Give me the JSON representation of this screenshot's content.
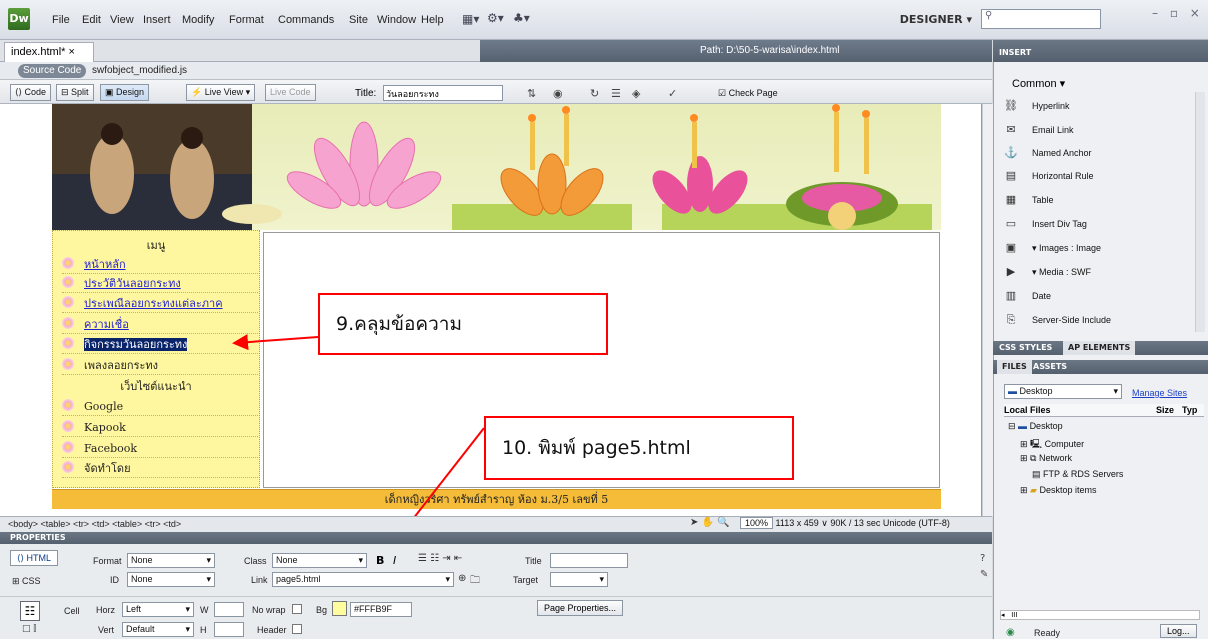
{
  "menubar": {
    "logo": "Dw",
    "items": [
      "File",
      "Edit",
      "View",
      "Insert",
      "Modify",
      "Format",
      "Commands",
      "Site",
      "Window",
      "Help"
    ],
    "workspace": "DESIGNER",
    "window_controls": "– ▫ ×"
  },
  "document": {
    "tab_label": "index.html*",
    "close": "×",
    "path": "Path:  D:\\50-5-warisa\\index.html",
    "source_code_label": "Source Code",
    "related_file": "swfobject_modified.js"
  },
  "toolbar": {
    "code": "Code",
    "split": "Split",
    "design": "Design",
    "live_view": "Live View",
    "live_code": "Live Code",
    "title_label": "Title:",
    "title_value": "วันลอยกระทง",
    "check_page": "Check Page"
  },
  "page": {
    "menu_heading": "เมนู",
    "menu_items": [
      {
        "label": "หน้าหลัก",
        "link": true
      },
      {
        "label": "ประวัติวันลอยกระทง",
        "link": true
      },
      {
        "label": "ประเพณีลอยกระทงแต่ละภาค",
        "link": true
      },
      {
        "label": "ความเชื่อ",
        "link": true
      },
      {
        "label": "กิจกรรมวันลอยกระทง",
        "link": false,
        "selected": true
      },
      {
        "label": "เพลงลอยกระทง",
        "link": false
      }
    ],
    "sites_heading": "เว็บไซต์แนะนำ",
    "site_items": [
      "Google",
      "Kapook",
      "Facebook",
      "จัดทำโดย"
    ],
    "footer": "เด็กหญิงวริศา ทรัพย์สำราญ ห้อง ม.3/5 เลขที่ 5"
  },
  "callouts": {
    "step9": "9.คลุมข้อความ",
    "step10": "10. พิมพ์ page5.html"
  },
  "statusbar": {
    "tag_selector": "<body> <table> <tr> <td> <table> <tr> <td>",
    "zoom": "100%",
    "size_info": "1113 x 459 ∨  90K / 13 sec  Unicode (UTF-8)"
  },
  "properties": {
    "title": "PROPERTIES",
    "html_tab": "HTML",
    "css_tab": "CSS",
    "format_label": "Format",
    "format_value": "None",
    "id_label": "ID",
    "id_value": "None",
    "class_label": "Class",
    "class_value": "None",
    "link_label": "Link",
    "link_value": "page5.html",
    "title_label": "Title",
    "target_label": "Target",
    "cell_label": "Cell",
    "horz_label": "Horz",
    "horz_value": "Left",
    "vert_label": "Vert",
    "vert_value": "Default",
    "w_label": "W",
    "h_label": "H",
    "nowrap_label": "No wrap",
    "header_label": "Header",
    "bg_label": "Bg",
    "bg_value": "#FFFB9F",
    "page_properties": "Page Properties..."
  },
  "right_panel": {
    "insert_title": "INSERT",
    "category": "Common",
    "insert_items": [
      {
        "label": "Hyperlink",
        "icon": "hyperlink-icon",
        "glyph": "⛓"
      },
      {
        "label": "Email Link",
        "icon": "email-icon",
        "glyph": "✉"
      },
      {
        "label": "Named Anchor",
        "icon": "anchor-icon",
        "glyph": "⚓"
      },
      {
        "label": "Horizontal Rule",
        "icon": "rule-icon",
        "glyph": "▤"
      },
      {
        "label": "Table",
        "icon": "table-icon",
        "glyph": "▦"
      },
      {
        "label": "Insert Div Tag",
        "icon": "div-icon",
        "glyph": "▭"
      },
      {
        "label": "Images : Image",
        "icon": "image-icon",
        "glyph": "▣"
      },
      {
        "label": "Media : SWF",
        "icon": "media-icon",
        "glyph": "▶"
      },
      {
        "label": "Date",
        "icon": "date-icon",
        "glyph": "▥"
      },
      {
        "label": "Server-Side Include",
        "icon": "include-icon",
        "glyph": "⎘"
      }
    ],
    "css_tabs": [
      "CSS STYLES",
      "AP ELEMENTS"
    ],
    "files_tabs": [
      "FILES",
      "ASSETS"
    ],
    "site_select": "Desktop",
    "manage_sites": "Manage Sites",
    "local_files": "Local Files",
    "cols": [
      "Size",
      "Typ"
    ],
    "tree": [
      "Desktop",
      "Computer",
      "Network",
      "FTP & RDS Servers",
      "Desktop items"
    ],
    "status": "Ready",
    "log_button": "Log..."
  }
}
